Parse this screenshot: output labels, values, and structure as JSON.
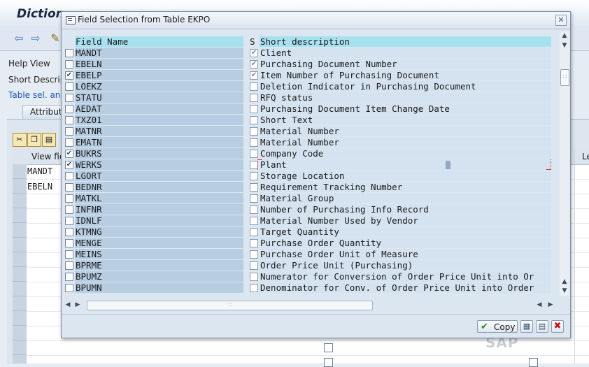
{
  "background": {
    "title": "Diction",
    "help_view": "Help View",
    "short_descr": "Short Descrip",
    "table_sel": "Table sel. and",
    "tab_attributes": "Attribut",
    "grid_header": "View fie",
    "grid_header_right": "Le",
    "grid_rows": [
      "MANDT",
      "EBELN"
    ],
    "watermark": "SAP"
  },
  "dialog": {
    "title": "Field Selection from Table EKPO",
    "close_icon": "close-icon",
    "columns": {
      "field_name": "Field Name",
      "s": "S",
      "short_description": "Short description"
    },
    "rows": [
      {
        "field": "MANDT",
        "selected": false,
        "key": true,
        "desc": "Client"
      },
      {
        "field": "EBELN",
        "selected": false,
        "key": true,
        "desc": "Purchasing Document Number"
      },
      {
        "field": "EBELP",
        "selected": true,
        "key": true,
        "desc": "Item Number of Purchasing Document"
      },
      {
        "field": "LOEKZ",
        "selected": false,
        "key": false,
        "desc": "Deletion Indicator in Purchasing Document"
      },
      {
        "field": "STATU",
        "selected": false,
        "key": false,
        "desc": "RFQ status"
      },
      {
        "field": "AEDAT",
        "selected": false,
        "key": false,
        "desc": "Purchasing Document Item Change Date"
      },
      {
        "field": "TXZ01",
        "selected": false,
        "key": false,
        "desc": "Short Text"
      },
      {
        "field": "MATNR",
        "selected": false,
        "key": false,
        "desc": "Material Number"
      },
      {
        "field": "EMATN",
        "selected": false,
        "key": false,
        "desc": "Material Number"
      },
      {
        "field": "BUKRS",
        "selected": true,
        "key": false,
        "desc": "Company Code"
      },
      {
        "field": "WERKS",
        "selected": true,
        "key": false,
        "desc": "Plant"
      },
      {
        "field": "LGORT",
        "selected": false,
        "key": false,
        "desc": "Storage Location"
      },
      {
        "field": "BEDNR",
        "selected": false,
        "key": false,
        "desc": "Requirement Tracking Number"
      },
      {
        "field": "MATKL",
        "selected": false,
        "key": false,
        "desc": "Material Group"
      },
      {
        "field": "INFNR",
        "selected": false,
        "key": false,
        "desc": "Number of Purchasing Info Record"
      },
      {
        "field": "IDNLF",
        "selected": false,
        "key": false,
        "desc": "Material Number Used by Vendor"
      },
      {
        "field": "KTMNG",
        "selected": false,
        "key": false,
        "desc": "Target Quantity"
      },
      {
        "field": "MENGE",
        "selected": false,
        "key": false,
        "desc": "Purchase Order Quantity"
      },
      {
        "field": "MEINS",
        "selected": false,
        "key": false,
        "desc": "Purchase Order Unit of Measure"
      },
      {
        "field": "BPRME",
        "selected": false,
        "key": false,
        "desc": "Order Price Unit (Purchasing)"
      },
      {
        "field": "BPUMZ",
        "selected": false,
        "key": false,
        "desc": "Numerator for Conversion of Order Price Unit into Or"
      },
      {
        "field": "BPUMN",
        "selected": false,
        "key": false,
        "desc": "Denominator for Conv. of Order Price Unit into Order"
      }
    ],
    "copy_label": "Copy",
    "colors": {
      "field_bg": "#b6cde2",
      "desc_bg": "#d5e3f0",
      "header_bg": "#a7e1f0",
      "copy_check": "#2a8a1e",
      "cancel": "#c0181c"
    }
  }
}
